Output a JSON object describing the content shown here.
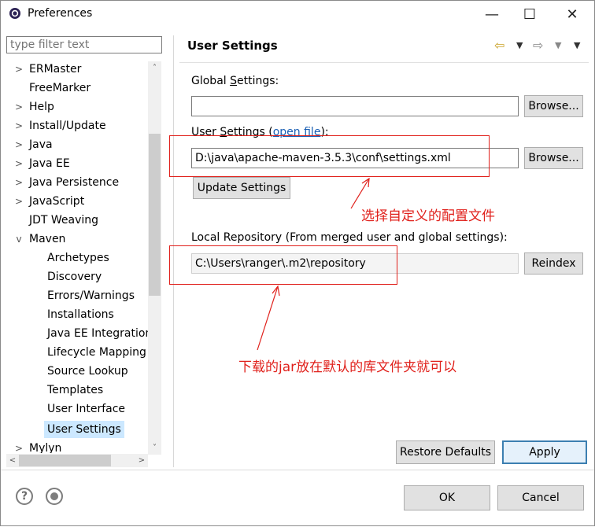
{
  "window": {
    "title": "Preferences",
    "minimize_glyph": "—",
    "maximize_glyph": "☐",
    "close_glyph": "✕"
  },
  "filter": {
    "placeholder": "type filter text"
  },
  "tree": {
    "items": [
      {
        "label": "ERMaster",
        "expander": ">"
      },
      {
        "label": "FreeMarker",
        "expander": ""
      },
      {
        "label": "Help",
        "expander": ">"
      },
      {
        "label": "Install/Update",
        "expander": ">"
      },
      {
        "label": "Java",
        "expander": ">"
      },
      {
        "label": "Java EE",
        "expander": ">"
      },
      {
        "label": "Java Persistence",
        "expander": ">"
      },
      {
        "label": "JavaScript",
        "expander": ">"
      },
      {
        "label": "JDT Weaving",
        "expander": ""
      },
      {
        "label": "Maven",
        "expander": "v"
      },
      {
        "label": "Archetypes",
        "expander": ""
      },
      {
        "label": "Discovery",
        "expander": ""
      },
      {
        "label": "Errors/Warnings",
        "expander": ""
      },
      {
        "label": "Installations",
        "expander": ""
      },
      {
        "label": "Java EE Integration",
        "expander": ""
      },
      {
        "label": "Lifecycle Mapping",
        "expander": ""
      },
      {
        "label": "Source Lookup",
        "expander": ""
      },
      {
        "label": "Templates",
        "expander": ""
      },
      {
        "label": "User Interface",
        "expander": ""
      },
      {
        "label": "User Settings",
        "expander": ""
      },
      {
        "label": "Mylyn",
        "expander": ">"
      }
    ],
    "selected": "User Settings"
  },
  "page": {
    "title": "User Settings",
    "global_label_pre": "Global ",
    "global_label_u": "S",
    "global_label_post": "ettings:",
    "global_value": "",
    "browse1": "Browse...",
    "user_label_pre": "User ",
    "user_label_u": "S",
    "user_label_mid": "ettings (",
    "open_file_link": "open file",
    "user_label_post": "):",
    "user_value": "D:\\java\\apache-maven-3.5.3\\conf\\settings.xml",
    "browse2": "Browse...",
    "update_settings": "Update Settings",
    "local_repo_label": "Local Repository (From merged user and global settings):",
    "local_repo_value": "C:\\Users\\ranger\\.m2\\repository",
    "reindex": "Reindex",
    "restore_defaults": "Restore Defaults",
    "apply": "Apply"
  },
  "annotations": {
    "note1": "选择自定义的配置文件",
    "note2": "下载的jar放在默认的库文件夹就可以",
    "color": "#e0201b"
  },
  "footer": {
    "help_glyph": "?",
    "ok": "OK",
    "cancel": "Cancel"
  }
}
